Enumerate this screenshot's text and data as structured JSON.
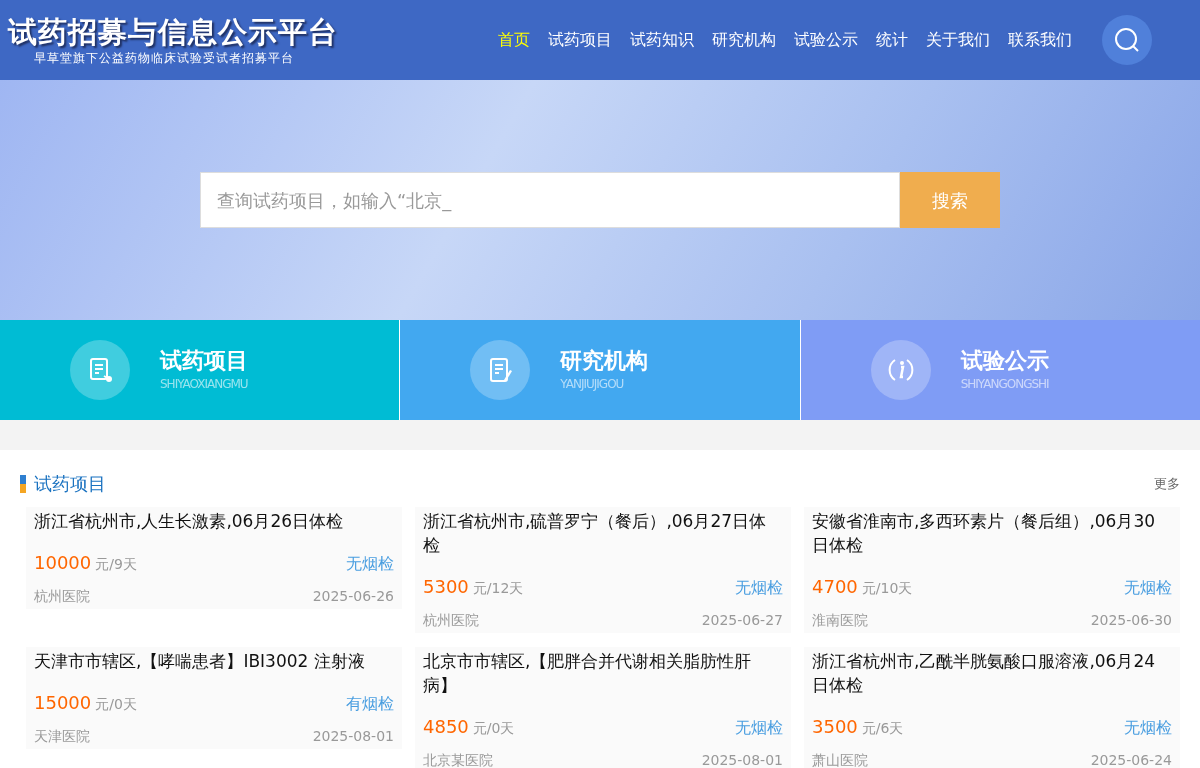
{
  "header": {
    "logo_title": "试药招募与信息公示平台",
    "logo_subtitle": "早草堂旗下公益药物临床试验受试者招募平台"
  },
  "nav": [
    {
      "label": "首页",
      "selected": true
    },
    {
      "label": "试药项目",
      "selected": false
    },
    {
      "label": "试药知识",
      "selected": false
    },
    {
      "label": "研究机构",
      "selected": false
    },
    {
      "label": "试验公示",
      "selected": false
    },
    {
      "label": "统计",
      "selected": false
    },
    {
      "label": "关于我们",
      "selected": false
    },
    {
      "label": "联系我们",
      "selected": false
    }
  ],
  "search": {
    "placeholder": "查询试药项目，如输入“北京_",
    "button": "搜索"
  },
  "tiles": [
    {
      "kind": "project",
      "title": "试药项目",
      "pinyin": "SHIYAOXIANGMU",
      "color": "#00bcd4"
    },
    {
      "kind": "institution",
      "title": "研究机构",
      "pinyin": "YANJIUJIGOU",
      "color": "#42a8f0"
    },
    {
      "kind": "notice",
      "title": "试验公示",
      "pinyin": "SHIYANGONGSHI",
      "color": "#7f9cf5"
    }
  ],
  "section": {
    "title": "试药项目",
    "more": "更多"
  },
  "cards": [
    {
      "title": "浙江省杭州市,人生长激素,06月26日体检",
      "price": "10000",
      "unit": "元/9天",
      "smoke": "无烟检",
      "hospital": "杭州医院",
      "date": "2025-06-26"
    },
    {
      "title": "浙江省杭州市,硫普罗宁（餐后）,06月27日体检",
      "price": "5300",
      "unit": "元/12天",
      "smoke": "无烟检",
      "hospital": "杭州医院",
      "date": "2025-06-27"
    },
    {
      "title": "安徽省淮南市,多西环素片（餐后组）,06月30日体检",
      "price": "4700",
      "unit": "元/10天",
      "smoke": "无烟检",
      "hospital": "淮南医院",
      "date": "2025-06-30"
    },
    {
      "title": "天津市市辖区,【哮喘患者】IBI3002 注射液",
      "price": "15000",
      "unit": "元/0天",
      "smoke": "有烟检",
      "hospital": "天津医院",
      "date": "2025-08-01"
    },
    {
      "title": "北京市市辖区,【肥胖合并代谢相关脂肪性肝病】",
      "price": "4850",
      "unit": "元/0天",
      "smoke": "无烟检",
      "hospital": "北京某医院",
      "date": "2025-08-01"
    },
    {
      "title": "浙江省杭州市,乙酰半胱氨酸口服溶液,06月24日体检",
      "price": "3500",
      "unit": "元/6天",
      "smoke": "无烟检",
      "hospital": "萧山医院",
      "date": "2025-06-24"
    }
  ]
}
